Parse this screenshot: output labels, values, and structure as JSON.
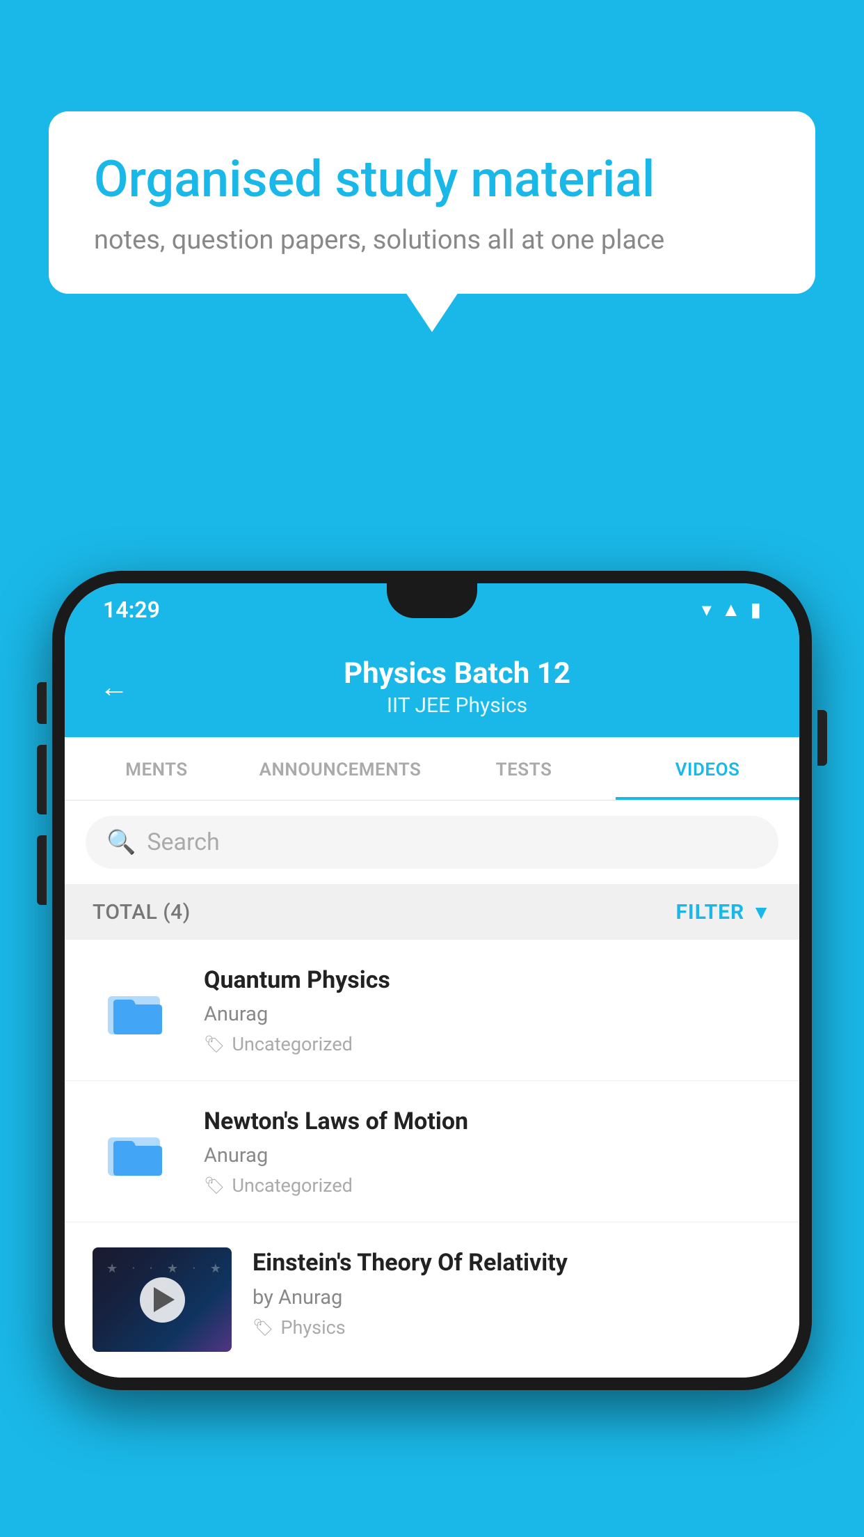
{
  "background_color": "#1ab8e8",
  "bubble": {
    "title": "Organised study material",
    "subtitle": "notes, question papers, solutions all at one place"
  },
  "phone": {
    "status_bar": {
      "time": "14:29"
    },
    "header": {
      "title": "Physics Batch 12",
      "subtitle": "IIT JEE   Physics",
      "back_label": "←"
    },
    "tabs": [
      {
        "label": "MENTS",
        "active": false
      },
      {
        "label": "ANNOUNCEMENTS",
        "active": false
      },
      {
        "label": "TESTS",
        "active": false
      },
      {
        "label": "VIDEOS",
        "active": true
      }
    ],
    "search": {
      "placeholder": "Search"
    },
    "filter_bar": {
      "total_label": "TOTAL (4)",
      "filter_label": "FILTER"
    },
    "videos": [
      {
        "id": "quantum",
        "title": "Quantum Physics",
        "author": "Anurag",
        "tag": "Uncategorized",
        "type": "folder",
        "thumbnail": null
      },
      {
        "id": "newton",
        "title": "Newton's Laws of Motion",
        "author": "Anurag",
        "tag": "Uncategorized",
        "type": "folder",
        "thumbnail": null
      },
      {
        "id": "einstein",
        "title": "Einstein's Theory Of Relativity",
        "author": "by Anurag",
        "tag": "Physics",
        "type": "video",
        "thumbnail": "cosmos"
      }
    ]
  }
}
